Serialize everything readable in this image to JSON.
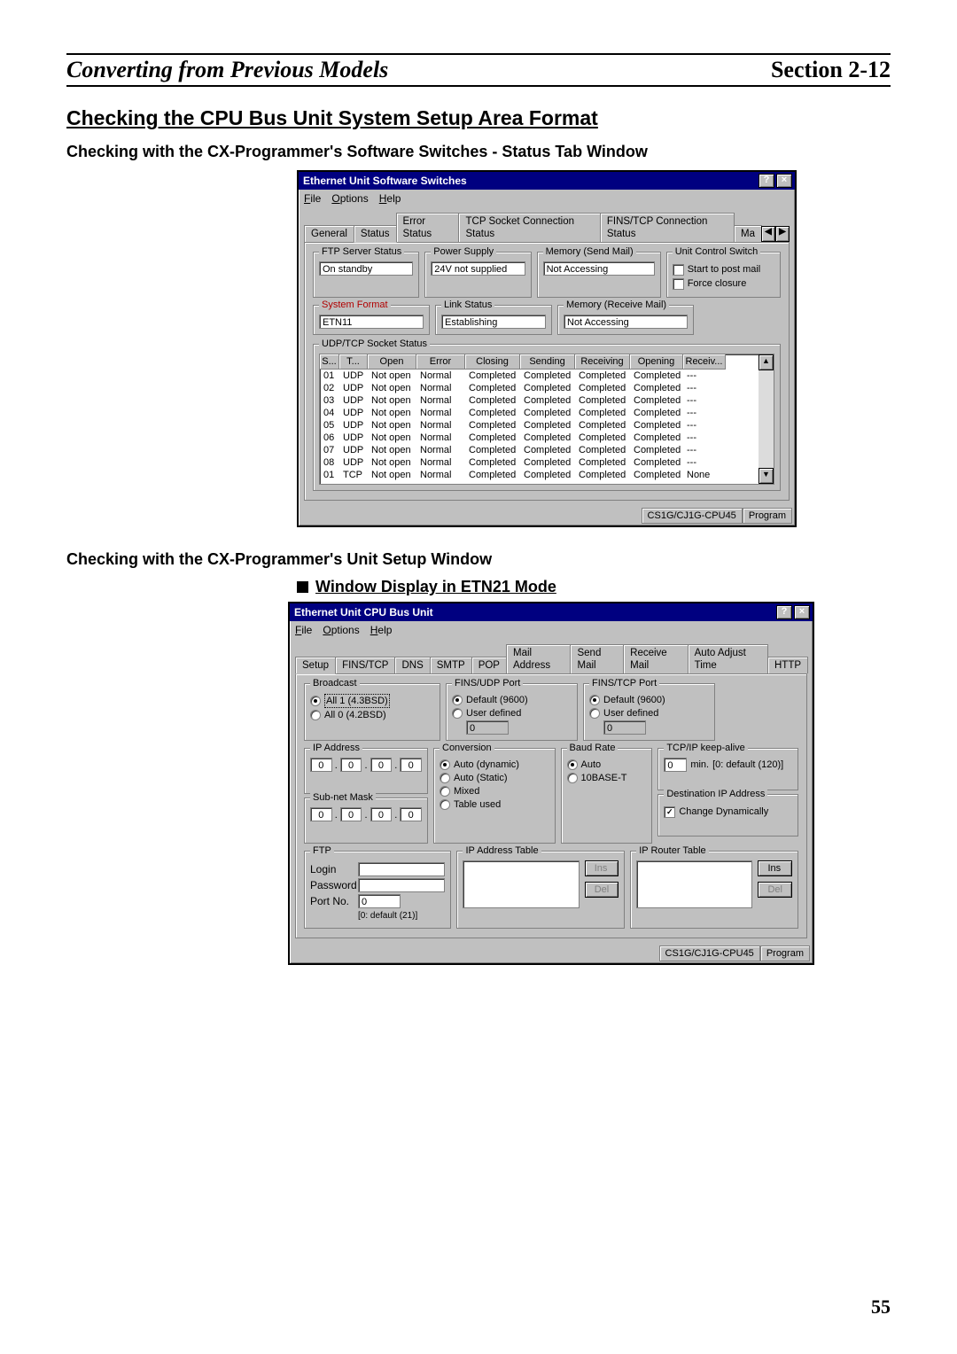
{
  "header": {
    "left": "Converting from Previous Models",
    "right": "Section 2-12"
  },
  "section_heading": "Checking the CPU Bus Unit System Setup Area Format",
  "sub1": "Checking with the CX-Programmer's Software Switches - Status Tab Window",
  "sub2": "Checking with the CX-Programmer's Unit Setup Window",
  "mode_heading": "Window Display in ETN21 Mode",
  "page_number": "55",
  "status_cpu": "CS1G/CJ1G-CPU45",
  "status_mode": "Program",
  "d1": {
    "title": "Ethernet Unit Software Switches",
    "help_btn": "?",
    "close_btn": "×",
    "menu": {
      "file": "File",
      "options": "Options",
      "help": "Help"
    },
    "tabs": [
      "General",
      "Status",
      "Error Status",
      "TCP Socket Connection Status",
      "FINS/TCP  Connection Status",
      "Ma"
    ],
    "tab_arrow_left": "◀",
    "tab_arrow_right": "▶",
    "grp": {
      "ftp": "FTP Server Status",
      "ftp_val": "On standby",
      "power": "Power Supply",
      "power_val": "24V not supplied",
      "memsend": "Memory (Send Mail)",
      "memsend_val": "Not Accessing",
      "ucs": "Unit Control Switch",
      "ucs_opt1": "Start to post mail",
      "ucs_opt2": "Force closure",
      "sysfmt": "System Format",
      "sysfmt_val": "ETN11",
      "link": "Link Status",
      "link_val": "Establishing",
      "memrecv": "Memory (Receive Mail)",
      "memrecv_val": "Not Accessing",
      "sock": "UDP/TCP Socket Status"
    },
    "cols": {
      "s": "S...",
      "t": "T...",
      "open": "Open",
      "error": "Error",
      "close": "Closing",
      "send": "Sending",
      "recv": "Receiving",
      "openg": "Opening",
      "recv2": "Receiv..."
    },
    "rows": [
      {
        "s": "01",
        "t": "UDP",
        "open": "Not open",
        "err": "Normal",
        "close": "Completed",
        "send": "Completed",
        "recv": "Completed",
        "openg": "Completed",
        "recv2": "---"
      },
      {
        "s": "02",
        "t": "UDP",
        "open": "Not open",
        "err": "Normal",
        "close": "Completed",
        "send": "Completed",
        "recv": "Completed",
        "openg": "Completed",
        "recv2": "---"
      },
      {
        "s": "03",
        "t": "UDP",
        "open": "Not open",
        "err": "Normal",
        "close": "Completed",
        "send": "Completed",
        "recv": "Completed",
        "openg": "Completed",
        "recv2": "---"
      },
      {
        "s": "04",
        "t": "UDP",
        "open": "Not open",
        "err": "Normal",
        "close": "Completed",
        "send": "Completed",
        "recv": "Completed",
        "openg": "Completed",
        "recv2": "---"
      },
      {
        "s": "05",
        "t": "UDP",
        "open": "Not open",
        "err": "Normal",
        "close": "Completed",
        "send": "Completed",
        "recv": "Completed",
        "openg": "Completed",
        "recv2": "---"
      },
      {
        "s": "06",
        "t": "UDP",
        "open": "Not open",
        "err": "Normal",
        "close": "Completed",
        "send": "Completed",
        "recv": "Completed",
        "openg": "Completed",
        "recv2": "---"
      },
      {
        "s": "07",
        "t": "UDP",
        "open": "Not open",
        "err": "Normal",
        "close": "Completed",
        "send": "Completed",
        "recv": "Completed",
        "openg": "Completed",
        "recv2": "---"
      },
      {
        "s": "08",
        "t": "UDP",
        "open": "Not open",
        "err": "Normal",
        "close": "Completed",
        "send": "Completed",
        "recv": "Completed",
        "openg": "Completed",
        "recv2": "---"
      },
      {
        "s": "01",
        "t": "TCP",
        "open": "Not open",
        "err": "Normal",
        "close": "Completed",
        "send": "Completed",
        "recv": "Completed",
        "openg": "Completed",
        "recv2": "None"
      }
    ],
    "scroll_up": "▲",
    "scroll_down": "▼"
  },
  "d2": {
    "title": "Ethernet Unit CPU Bus Unit",
    "help_btn": "?",
    "close_btn": "×",
    "menu": {
      "file": "File",
      "options": "Options",
      "help": "Help"
    },
    "tabs": [
      "Setup",
      "FINS/TCP",
      "DNS",
      "SMTP",
      "POP",
      "Mail Address",
      "Send Mail",
      "Receive Mail",
      "Auto Adjust Time",
      "HTTP"
    ],
    "grp": {
      "broadcast": "Broadcast",
      "bc_all1": "All 1 (4.3BSD)",
      "bc_all0": "All 0 (4.2BSD)",
      "finsudp": "FINS/UDP Port",
      "udp_def": "Default (9600)",
      "udp_user": "User defined",
      "udp_val": "0",
      "finstcp": "FINS/TCP Port",
      "tcp_def": "Default (9600)",
      "tcp_user": "User defined",
      "tcp_val": "0",
      "ip": "IP Address",
      "ip_vals": [
        "0",
        "0",
        "0",
        "0"
      ],
      "mask": "Sub-net Mask",
      "mask_vals": [
        "0",
        "0",
        "0",
        "0"
      ],
      "conv": "Conversion",
      "conv_auto_dyn": "Auto (dynamic)",
      "conv_auto_stat": "Auto (Static)",
      "conv_mixed": "Mixed",
      "conv_table": "Table used",
      "baud": "Baud Rate",
      "baud_auto": "Auto",
      "baud_10bt": "10BASE-T",
      "keep": "TCP/IP keep-alive",
      "keep_val": "0",
      "keep_min": "min.",
      "keep_def": "[0: default (120)]",
      "dest": "Destination IP Address",
      "dest_chk": "Change Dynamically",
      "ftp": "FTP",
      "ftp_login": "Login",
      "ftp_pw": "Password",
      "ftp_port": "Port No.",
      "ftp_port_val": "0",
      "ftp_port_hint": "[0: default (21)]",
      "ipat": "IP Address Table",
      "iprt": "IP Router Table",
      "ins": "Ins",
      "del": "Del"
    }
  }
}
